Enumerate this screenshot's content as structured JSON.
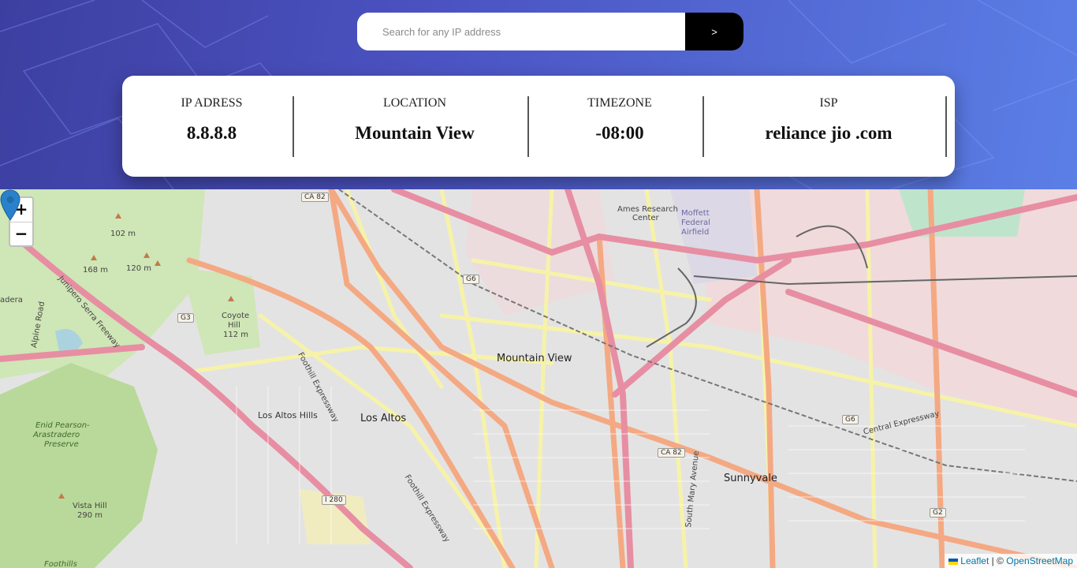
{
  "search": {
    "placeholder": "Search for any IP address",
    "value": "",
    "button_label": ">"
  },
  "info": {
    "ip": {
      "label": "IP ADRESS",
      "value": "8.8.8.8"
    },
    "location": {
      "label": "LOCATION",
      "value": "Mountain View"
    },
    "timezone": {
      "label": "TIMEZONE",
      "value": "-08:00"
    },
    "isp": {
      "label": "ISP",
      "value": "reliance jio .com"
    }
  },
  "map": {
    "zoom_in": "+",
    "zoom_out": "−",
    "attribution": {
      "leaflet": "Leaflet",
      "separator": " | © ",
      "osm": "OpenStreetMap"
    },
    "places": {
      "mountain_view": "Mountain View",
      "los_altos": "Los Altos",
      "los_altos_hills": "Los Altos Hills",
      "sunnyvale": "Sunnyvale",
      "ames": "Ames Research",
      "ames2": "Center",
      "moffett": "Moffett",
      "moffett2": "Federal",
      "moffett3": "Airfield",
      "coyote_hill": "Coyote",
      "coyote_hill2": "Hill",
      "coyote_hill3": "112 m",
      "vista_hill": "Vista Hill",
      "vista_hill2": "290 m",
      "enid": "Enid Pearson-",
      "enid2": "Arastradero",
      "enid3": "Preserve",
      "foothills": "Foothills",
      "adera": "adera",
      "m102": "102 m",
      "m168": "168 m",
      "m120": "120 m",
      "foothill_expwy": "Foothill Expressway",
      "central_expwy": "Central Expressway",
      "junipero": "Junipero Serra Freeway",
      "alpine": "Alpine Road",
      "south_mary": "South Mary Avenue"
    },
    "shields": {
      "ca82_top": "CA 82",
      "ca82_mid": "CA 82",
      "g6": "G6",
      "g6b": "G6",
      "g3": "G3",
      "g2": "G2",
      "i280": "I 280"
    },
    "colors": {
      "land": "#ececec",
      "residential": "#e0dfdf",
      "park": "#c8e6b0",
      "primary": "#f7a37a",
      "motorway": "#e8899f",
      "secondary": "#f6f3a8",
      "commercial": "#f2d5d7"
    }
  },
  "colors": {
    "header_start": "#3d3fa0",
    "header_end": "#5b7fe6",
    "button": "#000000",
    "marker": "#2a81cb"
  }
}
